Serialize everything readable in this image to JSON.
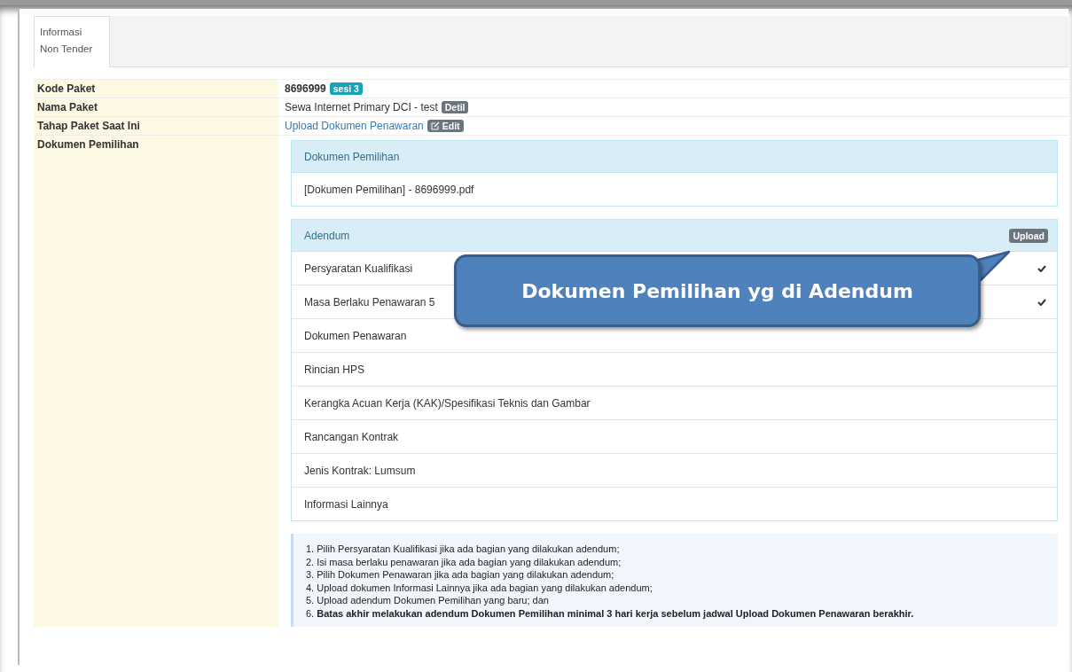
{
  "tabs": [
    {
      "label": "Informasi\nNon Tender",
      "selected": true
    }
  ],
  "info_rows": [
    {
      "label": "Kode Paket",
      "kind": "code",
      "value": "8696999",
      "badge": "sesi 3"
    },
    {
      "label": "Nama Paket",
      "kind": "name",
      "value": "Sewa Internet Primary DCI - test",
      "button": "Detil"
    },
    {
      "label": "Tahap Paket Saat Ini",
      "kind": "stage",
      "value": "Upload Dokumen Penawaran",
      "button": "Edit"
    },
    {
      "label": "Dokumen Pemilihan",
      "kind": "documents"
    }
  ],
  "dokumen_panel": {
    "heading": "Dokumen Pemilihan",
    "items": [
      "[Dokumen Pemilihan] - 8696999.pdf"
    ]
  },
  "adendum_panel": {
    "heading": "Adendum",
    "upload_button": "Upload",
    "items": [
      {
        "label": "Persyaratan Kualifikasi",
        "checked": true
      },
      {
        "label": "Masa Berlaku Penawaran 5",
        "checked": true
      },
      {
        "label": "Dokumen Penawaran",
        "checked": false
      },
      {
        "label": "Rincian HPS",
        "checked": false
      },
      {
        "label": "Kerangka Acuan Kerja (KAK)/Spesifikasi Teknis dan Gambar",
        "checked": false
      },
      {
        "label": "Rancangan Kontrak",
        "checked": false
      },
      {
        "label": "Jenis Kontrak: Lumsum",
        "checked": false
      },
      {
        "label": "Informasi Lainnya",
        "checked": false
      }
    ]
  },
  "notes": [
    {
      "text": "1. Pilih Persyaratan Kualifikasi jika ada bagian yang dilakukan adendum;",
      "bold": false
    },
    {
      "text": "2. Isi masa berlaku penawaran jika ada bagian yang dilakukan adendum;",
      "bold": false
    },
    {
      "text": "3. Pilih Dokumen Penawaran jika ada bagian yang dilakukan adendum;",
      "bold": false
    },
    {
      "text": "4. Upload dokumen Informasi Lainnya jika ada bagian yang dilakukan adendum;",
      "bold": false
    },
    {
      "text": "5. Upload adendum Dokumen Pemilihan yang baru; dan",
      "bold": false
    },
    {
      "text": "6. **Batas akhir melakukan adendum Dokumen Pemilihan minimal 3 hari kerja sebelum jadwal Upload Dokumen Penawaran berakhir.**",
      "bold": false
    }
  ],
  "callout": {
    "text": "Dokumen Pemilihan yg di Adendum"
  }
}
